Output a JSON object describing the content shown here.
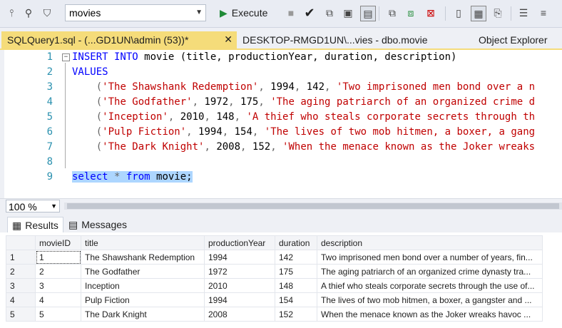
{
  "toolbar": {
    "database": "movies",
    "execute_label": "Execute"
  },
  "tabs": {
    "active": "SQLQuery1.sql - (...GD1UN\\admin (53))*",
    "second": "DESKTOP-RMGD1UN\\...vies - dbo.movie",
    "third": "Object Explorer"
  },
  "editor": {
    "line_numbers": [
      "1",
      "2",
      "3",
      "4",
      "5",
      "6",
      "7",
      "8",
      "9"
    ],
    "line1": {
      "kw1": "INSERT INTO",
      "rest": " movie (title, productionYear, duration, description)"
    },
    "line2": {
      "kw": "VALUES"
    },
    "rows": [
      {
        "title": "'The Shawshank Redemption'",
        "year": "1994",
        "dur": "142",
        "desc": "'Two imprisoned men bond over a n"
      },
      {
        "title": "'The Godfather'",
        "year": "1972",
        "dur": "175",
        "desc": "'The aging patriarch of an organized crime d"
      },
      {
        "title": "'Inception'",
        "year": "2010",
        "dur": "148",
        "desc": "'A thief who steals corporate secrets through th"
      },
      {
        "title": "'Pulp Fiction'",
        "year": "1994",
        "dur": "154",
        "desc": "'The lives of two mob hitmen, a boxer, a gang"
      },
      {
        "title": "'The Dark Knight'",
        "year": "2008",
        "dur": "152",
        "desc": "'When the menace known as the Joker wreaks"
      }
    ],
    "line9": {
      "kw1": "select",
      "star": " * ",
      "kw2": "from",
      "rest": " movie;"
    }
  },
  "zoom": "100 %",
  "result_tabs": {
    "results": "Results",
    "messages": "Messages"
  },
  "grid": {
    "headers": [
      "movieID",
      "title",
      "productionYear",
      "duration",
      "description"
    ],
    "rows": [
      [
        "1",
        "1",
        "The Shawshank Redemption",
        "1994",
        "142",
        "Two imprisoned men bond over a number of years, fin..."
      ],
      [
        "2",
        "2",
        "The Godfather",
        "1972",
        "175",
        "The aging patriarch of an organized crime dynasty tra..."
      ],
      [
        "3",
        "3",
        "Inception",
        "2010",
        "148",
        "A thief who steals corporate secrets through the use of..."
      ],
      [
        "4",
        "4",
        "Pulp Fiction",
        "1994",
        "154",
        "The lives of two mob hitmen, a boxer, a gangster and ..."
      ],
      [
        "5",
        "5",
        "The Dark Knight",
        "2008",
        "152",
        "When the menace known as the Joker wreaks havoc ..."
      ]
    ]
  }
}
